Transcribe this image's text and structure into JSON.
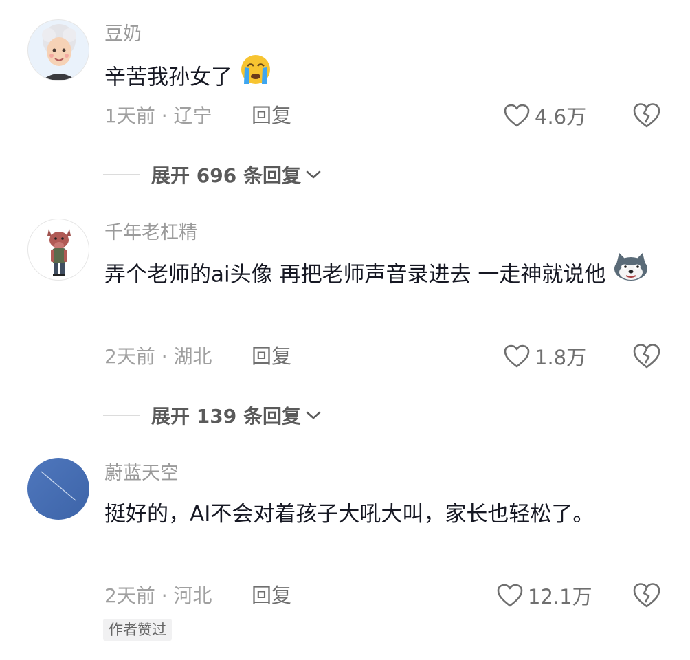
{
  "comments": [
    {
      "username": "豆奶",
      "text": "辛苦我孙女了",
      "emoji": "crying-face-emoji",
      "time": "1天前",
      "location": "辽宁",
      "reply_label": "回复",
      "likes": "4.6万",
      "expand": "展开 696 条回复"
    },
    {
      "username": "千年老杠精",
      "text": "弄个老师的ai头像  再把老师声音录进去   一走神就说他",
      "emoji": "doge-emoji",
      "time": "2天前",
      "location": "湖北",
      "reply_label": "回复",
      "likes": "1.8万",
      "expand": "展开 139 条回复"
    },
    {
      "username": "蔚蓝天空",
      "text": "挺好的，AI不会对着孩子大吼大叫，家长也轻松了。",
      "time": "2天前",
      "location": "河北",
      "reply_label": "回复",
      "likes": "12.1万",
      "badge": "作者赞过"
    }
  ],
  "meta_separator": " · ",
  "icons": {
    "like": "heart-outline-icon",
    "dislike": "broken-heart-icon",
    "expand": "chevron-down-icon"
  }
}
